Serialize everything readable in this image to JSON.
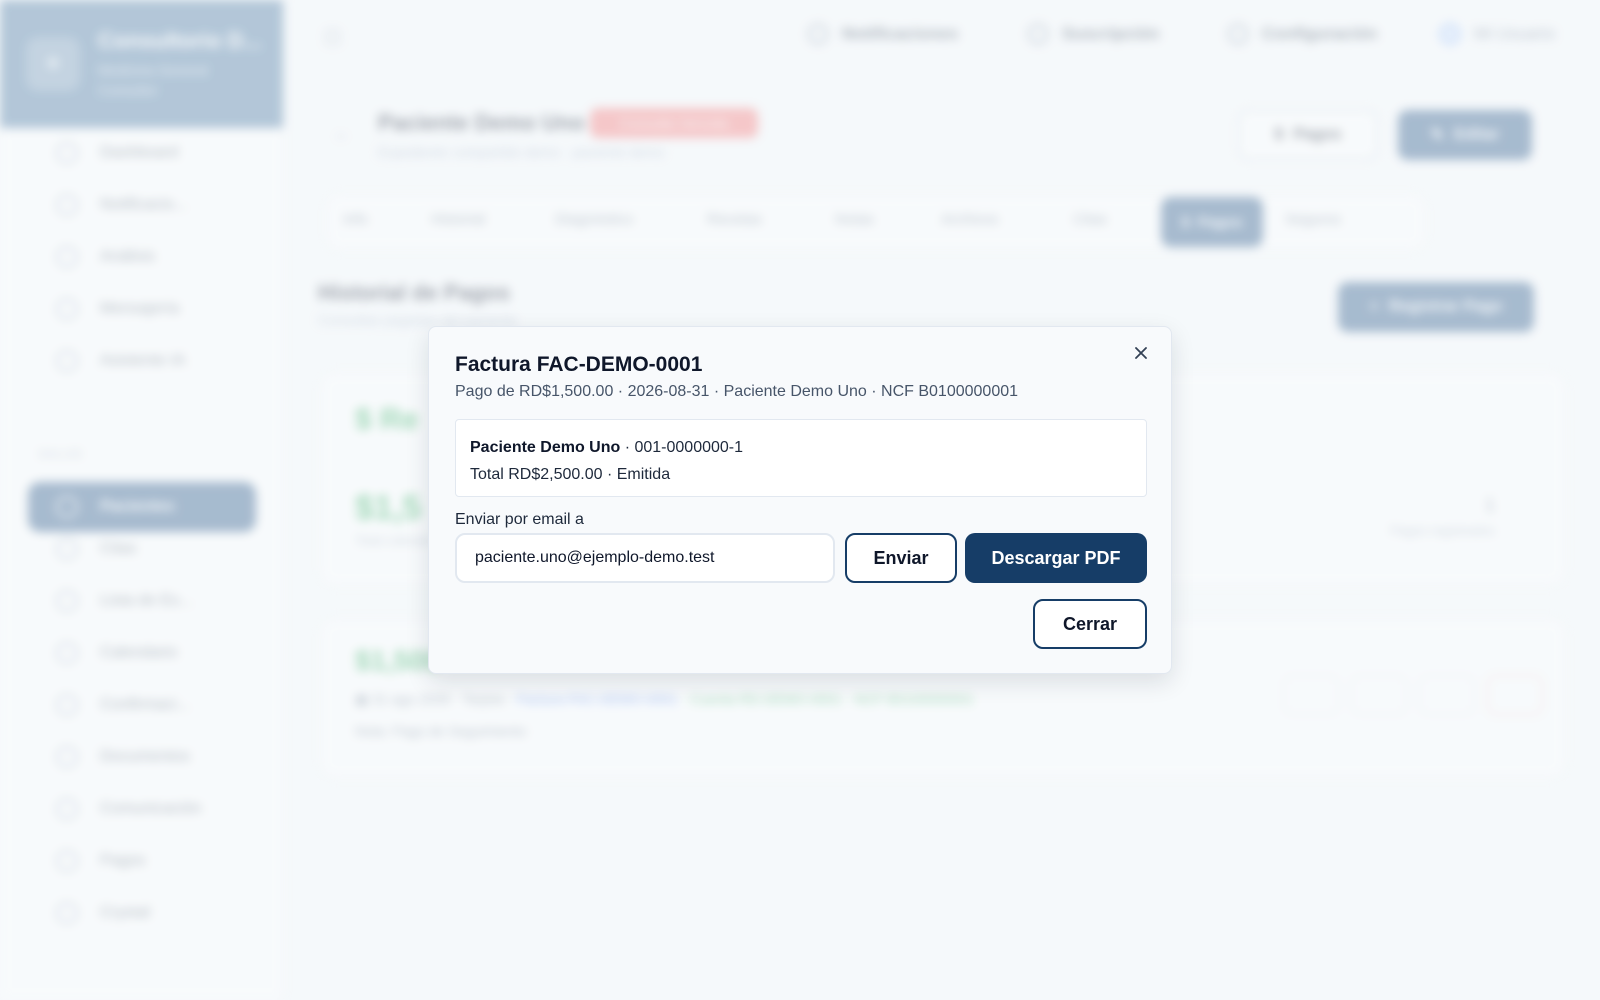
{
  "background": {
    "brand": {
      "name": "Consultorio D...",
      "subtitle": "Medicina General",
      "subtitle2": "Consultor"
    },
    "sidebar": {
      "items_top": [
        {
          "label": "Dashboard",
          "icon": "home-icon"
        },
        {
          "label": "Notificacio...",
          "icon": "bell-icon"
        },
        {
          "label": "Análisis",
          "icon": "chart-icon"
        },
        {
          "label": "Mensajería",
          "icon": "message-icon"
        },
        {
          "label": "Asistente IA",
          "icon": "sparkle-icon"
        }
      ],
      "section_label": "SALUD",
      "active_item": {
        "label": "Pacientes",
        "icon": "users-icon"
      },
      "items_bottom": [
        {
          "label": "Citas",
          "icon": "calendar-icon"
        },
        {
          "label": "Lista de Es...",
          "icon": "list-icon"
        },
        {
          "label": "Calendario",
          "icon": "calendar-icon"
        },
        {
          "label": "Confirmaci...",
          "icon": "check-icon"
        },
        {
          "label": "Documentos",
          "icon": "file-icon"
        },
        {
          "label": "Comunicación",
          "icon": "chat-icon"
        },
        {
          "label": "Pagos",
          "icon": "card-icon"
        },
        {
          "label": "Crystal",
          "icon": "gem-icon"
        }
      ]
    },
    "topbar": {
      "notifications": "Notificaciones",
      "subscription": "Suscripción",
      "settings": "Configuración",
      "user": "Mi Usuario"
    },
    "patient": {
      "name": "Paciente Demo Uno",
      "badge": "Consulta Vencida",
      "subtitle": "Expediente compartido demo · paciente demo"
    },
    "header_buttons": {
      "pagos": "Pagos",
      "editar": "Editar"
    },
    "tabs": [
      "Info",
      "Historial",
      "Diagnóstico",
      "Recetas",
      "Notas",
      "Archivos",
      "Citas",
      "Pagos",
      "Seguros"
    ],
    "payments": {
      "title": "Historial de Pagos",
      "subtitle": "Consultas pagadas del paciente",
      "register_button": "Registrar Pago",
      "card1_heading": "Re",
      "card1_amount": "$1,5",
      "card1_small": "Total cobrado",
      "card1_right_num": "1",
      "card1_right": "Pagos registrados",
      "card2_amount": "$1,500",
      "card2_line_a": "31 ago 2026 · Tarjeta ·",
      "card2_line_b": "Factura FAC-DEMO-0001",
      "card2_line_c": "· Cuenta RD-DEMO-0001 · NCF B0100000001",
      "card2_note": "Nota: Pago de Seguimiento"
    }
  },
  "modal": {
    "title": "Factura FAC-DEMO-0001",
    "subtitle": "Pago de RD$1,500.00 · 2026-08-31 · Paciente Demo Uno · NCF B0100000001",
    "info_name": "Paciente Demo Uno",
    "info_id": " · 001-0000000-1",
    "info_total": "Total RD$2,500.00 · Emitida",
    "email_label": "Enviar por email a",
    "email_value": "paciente.uno@ejemplo-demo.test",
    "send_button": "Enviar",
    "pdf_button": "Descargar PDF",
    "close_button": "Cerrar"
  }
}
